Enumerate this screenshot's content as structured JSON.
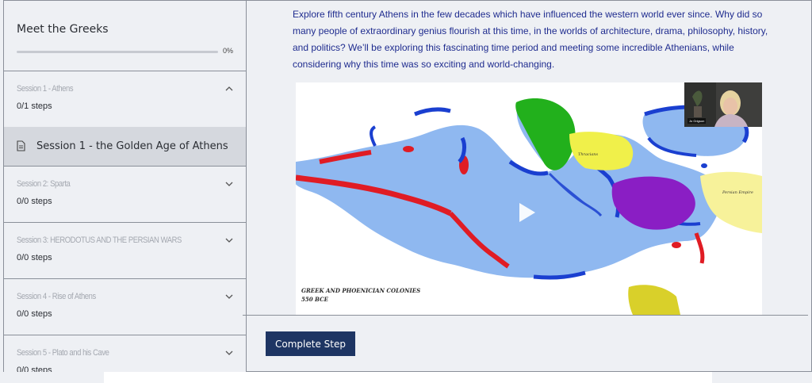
{
  "course": {
    "title": "Meet the Greeks",
    "progress_label": "0%",
    "progress_value": 0
  },
  "sessions": [
    {
      "title": "Session 1 - Athens",
      "steps": "0/1 steps",
      "expanded": true,
      "chevron": "chevron-up-icon"
    },
    {
      "title": "Session 2: Sparta",
      "steps": "0/0 steps",
      "expanded": false,
      "chevron": "chevron-down-icon"
    },
    {
      "title": "Session 3: HERODOTUS AND THE PERSIAN WARS",
      "steps": "0/0 steps",
      "expanded": false,
      "chevron": "chevron-down-icon"
    },
    {
      "title": "Session 4 - Rise of Athens",
      "steps": "0/0 steps",
      "expanded": false,
      "chevron": "chevron-down-icon"
    },
    {
      "title": "Session 5 - Plato and his Cave",
      "steps": "0/0 steps",
      "expanded": false,
      "chevron": "chevron-down-icon"
    }
  ],
  "active_step": {
    "label": "Session 1 - the Golden Age of Athens",
    "icon": "document-icon"
  },
  "main": {
    "intro_text": "Explore fifth century Athens in the few decades which have influenced the western world ever since. Why did so many people of extraordinary genius flourish at this time, in the worlds of architecture, drama, philosophy, history, and politics? We’ll be exploring this fascinating time period and meeting some incredible Athenians, while considering why this time was so exciting and world-changing.",
    "video": {
      "map_caption_line1": "GREEK AND PHOENICIAN COLONIES",
      "map_caption_line2": "550 BCE",
      "map_label_thracians": "Thracians",
      "map_label_persian": "Persian Empire",
      "presenter_label": "Jo Grigson",
      "play_icon": "play-icon"
    },
    "complete_button": "Complete Step"
  },
  "colors": {
    "accent": "#1e3563",
    "intro_text": "#1f2c8f",
    "sea": "#8fb8f0",
    "greek": "#1a3fd0",
    "phoenician": "#e01c24"
  }
}
